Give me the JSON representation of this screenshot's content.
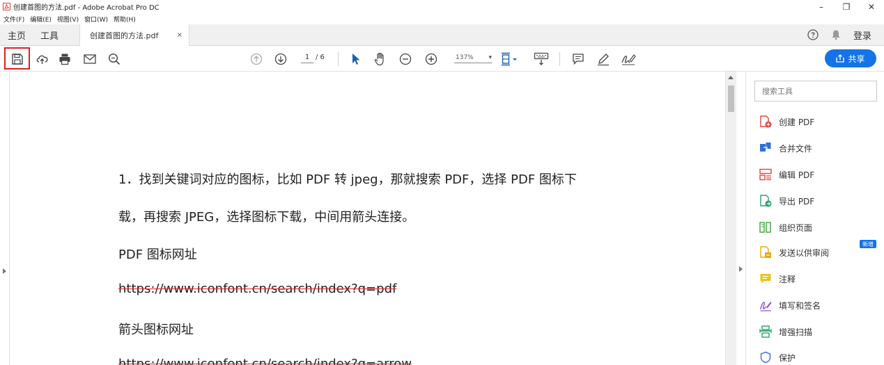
{
  "window": {
    "title": "创建首图的方法.pdf - Adobe Acrobat Pro DC",
    "minimize": "–",
    "restore": "❐",
    "close": "✕"
  },
  "menu": [
    "文件(F)",
    "编辑(E)",
    "视图(V)",
    "窗口(W)",
    "帮助(H)"
  ],
  "tabs": {
    "home": "主页",
    "tools": "工具",
    "document": "创建首图的方法.pdf",
    "close": "×",
    "login": "登录"
  },
  "toolbar": {
    "page_current": "1",
    "page_total": "/ 6",
    "zoom": "137%",
    "zoom_arrow": "▾",
    "share": "共享"
  },
  "document": {
    "lines": [
      "1．找到关键词对应的图标，比如 PDF 转 jpeg，那就搜索 PDF，选择 PDF 图标下",
      "载，再搜索 JPEG，选择图标下载，中间用箭头连接。",
      "PDF 图标网址",
      "https://www.iconfont.cn/search/index?q=pdf",
      "箭头图标网址",
      "https://www.iconfont.cn/search/index?q=arrow"
    ]
  },
  "tools_pane": {
    "search_placeholder": "搜索工具",
    "new_badge": "新增",
    "items": [
      {
        "label": "创建 PDF",
        "icon": "create-pdf-icon",
        "color": "#e8413c"
      },
      {
        "label": "合并文件",
        "icon": "combine-files-icon",
        "color": "#2f6fd6"
      },
      {
        "label": "编辑 PDF",
        "icon": "edit-pdf-icon",
        "color": "#e8413c"
      },
      {
        "label": "导出 PDF",
        "icon": "export-pdf-icon",
        "color": "#2aa16a"
      },
      {
        "label": "组织页面",
        "icon": "organize-pages-icon",
        "color": "#3aa335"
      },
      {
        "label": "发送以供审阅",
        "icon": "send-for-review-icon",
        "color": "#e8a913"
      },
      {
        "label": "注释",
        "icon": "comment-icon",
        "color": "#e8c21b"
      },
      {
        "label": "填写和签名",
        "icon": "fill-sign-icon",
        "color": "#8c4fd6"
      },
      {
        "label": "增强扫描",
        "icon": "enhance-scan-icon",
        "color": "#2aa16a"
      },
      {
        "label": "保护",
        "icon": "protect-icon",
        "color": "#4a6fd6"
      }
    ]
  },
  "colors": {
    "accent": "#1473e6",
    "highlight": "#e01e1e"
  }
}
